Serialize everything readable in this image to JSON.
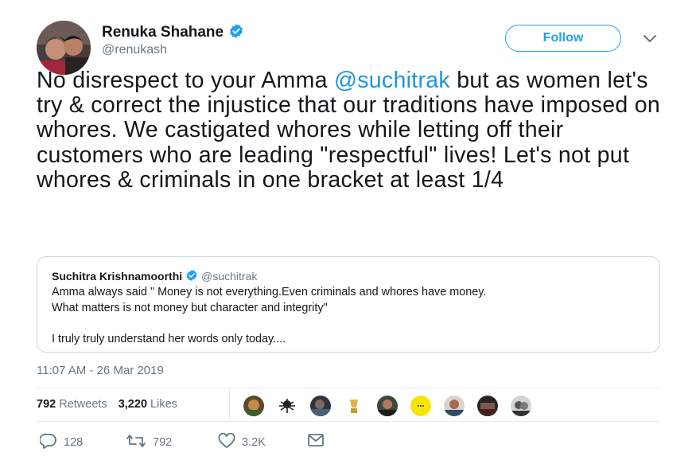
{
  "author": {
    "name": "Renuka Shahane",
    "handle": "@renukash"
  },
  "follow_label": "Follow",
  "tweet": {
    "text_before": "No disrespect to your Amma ",
    "mention": "@suchitrak",
    "text_after": " but as women let's try & correct the injustice that our traditions have imposed on whores. We castigated whores while letting off their customers who are leading \"respectful\" lives! Let's not put whores & criminals in one bracket at least 1/4"
  },
  "quoted": {
    "name": "Suchitra Krishnamoorthi",
    "handle": "@suchitrak",
    "line1": "Amma always said \" Money is not everything.Even criminals and whores have money.",
    "line2": "What matters is not money but character and integrity\"",
    "line3": "I  truly truly understand her words only today...."
  },
  "timestamp": "11:07 AM - 26 Mar 2019",
  "stats": {
    "retweets_count": "792",
    "retweets_label": "Retweets",
    "likes_count": "3,220",
    "likes_label": "Likes"
  },
  "actions": {
    "replies": "128",
    "retweets": "792",
    "likes": "3.2K"
  },
  "colors": {
    "accent": "#1da1f2",
    "mention": "#1b95e0",
    "muted": "#657786"
  }
}
